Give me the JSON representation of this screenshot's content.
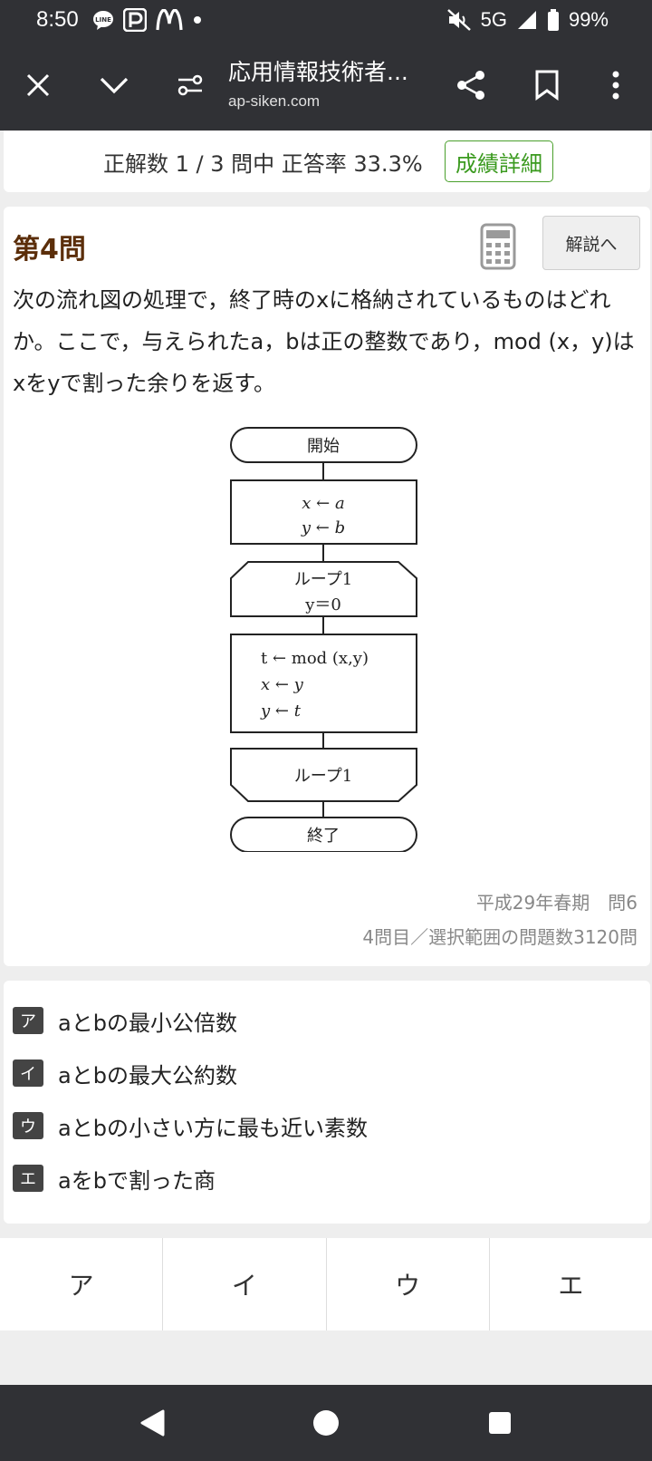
{
  "status_bar": {
    "time": "8:50",
    "network": "5G",
    "battery": "99%",
    "icons": [
      "line-icon",
      "paypay-icon",
      "mcdonalds-icon",
      "dot-icon",
      "mute-icon",
      "signal-icon",
      "battery-icon"
    ]
  },
  "toolbar": {
    "title": "応用情報技術者...",
    "url": "ap-siken.com",
    "icons": [
      "close-icon",
      "chevron-down-icon",
      "page-settings-icon",
      "share-icon",
      "bookmark-icon",
      "more-icon"
    ]
  },
  "score": {
    "text": "正解数 1 / 3 問中 正答率 33.3%",
    "details_link": "成績詳細",
    "link_color": "#3b9a1f"
  },
  "question": {
    "heading": "第4問",
    "explain_button": "解説へ",
    "body": "次の流れ図の処理で，終了時のxに格納されているものはどれか。ここで，与えられたa，bは正の整数であり，mod (x，y)はxをyで割った余りを返す。",
    "source": "平成29年春期　問6",
    "count": "4問目／選択範囲の問題数3120問",
    "heading_color": "#5b2e0a"
  },
  "flowchart": {
    "start": "開始",
    "assign1_line1": "x ← a",
    "assign1_line2": "y ← b",
    "loop_start_line1": "ループ1",
    "loop_start_line2": "y＝0",
    "body_line1": "t ← mod (x,y)",
    "body_line2": "x ← y",
    "body_line3": "y ← t",
    "loop_end": "ループ1",
    "end": "終了"
  },
  "choices": [
    {
      "badge": "ア",
      "text": "aとbの最小公倍数"
    },
    {
      "badge": "イ",
      "text": "aとbの最大公約数"
    },
    {
      "badge": "ウ",
      "text": "aとbの小さい方に最も近い素数"
    },
    {
      "badge": "エ",
      "text": "aをbで割った商"
    }
  ],
  "answers": [
    "ア",
    "イ",
    "ウ",
    "エ"
  ],
  "nav_bar": {
    "icons": [
      "back-icon",
      "home-icon",
      "recents-icon"
    ]
  }
}
